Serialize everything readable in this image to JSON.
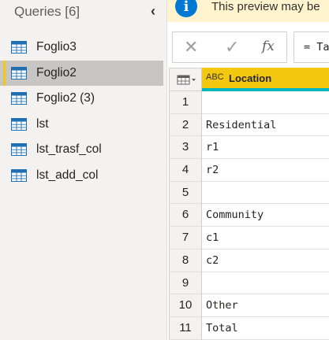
{
  "queries_pane": {
    "title": "Queries [6]",
    "collapse_icon": "chevron-left-icon",
    "items": [
      {
        "label": "Foglio3",
        "selected": false
      },
      {
        "label": "Foglio2",
        "selected": true
      },
      {
        "label": "Foglio2 (3)",
        "selected": false
      },
      {
        "label": "lst",
        "selected": false
      },
      {
        "label": "lst_trasf_col",
        "selected": false
      },
      {
        "label": "lst_add_col",
        "selected": false
      }
    ]
  },
  "banner": {
    "icon": "i",
    "text": "This preview may be"
  },
  "formula_bar": {
    "cancel_icon": "✕",
    "confirm_icon": "✓",
    "fx_label": "fx",
    "formula": "= Ta"
  },
  "grid": {
    "type_icon": "ABC",
    "column_name": "Location",
    "rows": [
      {
        "num": "1",
        "value": ""
      },
      {
        "num": "2",
        "value": "Residential"
      },
      {
        "num": "3",
        "value": "r1"
      },
      {
        "num": "4",
        "value": "r2"
      },
      {
        "num": "5",
        "value": ""
      },
      {
        "num": "6",
        "value": "Community"
      },
      {
        "num": "7",
        "value": "c1"
      },
      {
        "num": "8",
        "value": "c2"
      },
      {
        "num": "9",
        "value": ""
      },
      {
        "num": "10",
        "value": "Other"
      },
      {
        "num": "11",
        "value": "Total"
      }
    ]
  },
  "colors": {
    "accent_yellow": "#f2c811",
    "info_blue": "#0078d4",
    "banner_bg": "#fff4ce",
    "column_underline": "#00b7c3"
  }
}
